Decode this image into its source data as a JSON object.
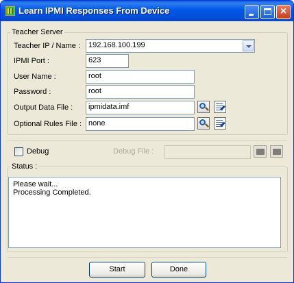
{
  "window": {
    "title": "Learn IPMI Responses From Device",
    "icon": "app-grid-icon"
  },
  "teacher_server": {
    "legend": "Teacher Server",
    "ip_label": "Teacher IP / Name :",
    "ip_value": "192.168.100.199",
    "port_label": "IPMI Port :",
    "port_value": "623",
    "user_label": "User Name :",
    "user_value": "root",
    "password_label": "Password :",
    "password_value": "root",
    "output_label": "Output Data File :",
    "output_value": "ipmidata.imf",
    "rules_label": "Optional Rules File :",
    "rules_value": "none"
  },
  "debug": {
    "checkbox_label": "Debug",
    "checked": false,
    "file_label": "Debug File :",
    "file_value": ""
  },
  "status": {
    "legend": "Status :",
    "line1": "Please wait...",
    "line2": "Processing Completed."
  },
  "buttons": {
    "start": "Start",
    "done": "Done"
  },
  "colors": {
    "title_bar": "#0058e6",
    "dialog_bg": "#ece9d8",
    "field_border": "#7f9db9"
  }
}
